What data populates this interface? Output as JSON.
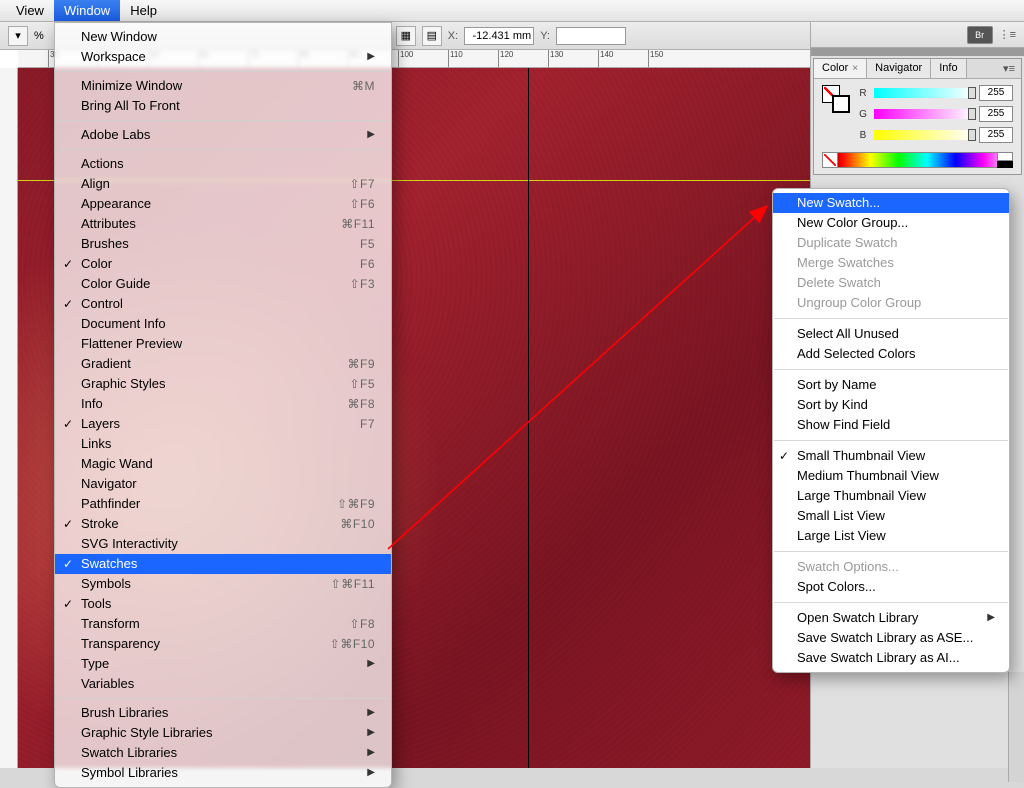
{
  "menubar": {
    "items": [
      "View",
      "Window",
      "Help"
    ],
    "active_index": 1
  },
  "toolbar": {
    "x_label": "X:",
    "y_label": "Y:",
    "x_value": "-12.431 mm",
    "pct": "%"
  },
  "ruler": {
    "ticks": [
      30,
      40,
      50,
      60,
      70,
      80,
      90,
      100,
      110,
      120,
      130,
      140,
      150
    ]
  },
  "window_menu": {
    "groups": [
      [
        {
          "label": "New Window"
        },
        {
          "label": "Workspace",
          "submenu": true
        }
      ],
      [
        {
          "label": "Minimize Window",
          "shortcut": "⌘M"
        },
        {
          "label": "Bring All To Front"
        }
      ],
      [
        {
          "label": "Adobe Labs",
          "submenu": true
        }
      ],
      [
        {
          "label": "Actions"
        },
        {
          "label": "Align",
          "shortcut": "⇧F7"
        },
        {
          "label": "Appearance",
          "shortcut": "⇧F6"
        },
        {
          "label": "Attributes",
          "shortcut": "⌘F11"
        },
        {
          "label": "Brushes",
          "shortcut": "F5"
        },
        {
          "label": "Color",
          "shortcut": "F6",
          "checked": true
        },
        {
          "label": "Color Guide",
          "shortcut": "⇧F3"
        },
        {
          "label": "Control",
          "checked": true
        },
        {
          "label": "Document Info"
        },
        {
          "label": "Flattener Preview"
        },
        {
          "label": "Gradient",
          "shortcut": "⌘F9"
        },
        {
          "label": "Graphic Styles",
          "shortcut": "⇧F5"
        },
        {
          "label": "Info",
          "shortcut": "⌘F8"
        },
        {
          "label": "Layers",
          "shortcut": "F7",
          "checked": true
        },
        {
          "label": "Links"
        },
        {
          "label": "Magic Wand"
        },
        {
          "label": "Navigator"
        },
        {
          "label": "Pathfinder",
          "shortcut": "⇧⌘F9"
        },
        {
          "label": "Stroke",
          "shortcut": "⌘F10",
          "checked": true
        },
        {
          "label": "SVG Interactivity"
        },
        {
          "label": "Swatches",
          "checked": true,
          "selected": true
        },
        {
          "label": "Symbols",
          "shortcut": "⇧⌘F11"
        },
        {
          "label": "Tools",
          "checked": true
        },
        {
          "label": "Transform",
          "shortcut": "⇧F8"
        },
        {
          "label": "Transparency",
          "shortcut": "⇧⌘F10"
        },
        {
          "label": "Type",
          "submenu": true
        },
        {
          "label": "Variables"
        }
      ],
      [
        {
          "label": "Brush Libraries",
          "submenu": true
        },
        {
          "label": "Graphic Style Libraries",
          "submenu": true
        },
        {
          "label": "Swatch Libraries",
          "submenu": true
        },
        {
          "label": "Symbol Libraries",
          "submenu": true
        }
      ]
    ]
  },
  "swatches_flyout": {
    "groups": [
      [
        {
          "label": "New Swatch...",
          "selected": true
        },
        {
          "label": "New Color Group..."
        },
        {
          "label": "Duplicate Swatch",
          "disabled": true
        },
        {
          "label": "Merge Swatches",
          "disabled": true
        },
        {
          "label": "Delete Swatch",
          "disabled": true
        },
        {
          "label": "Ungroup Color Group",
          "disabled": true
        }
      ],
      [
        {
          "label": "Select All Unused"
        },
        {
          "label": "Add Selected Colors"
        }
      ],
      [
        {
          "label": "Sort by Name"
        },
        {
          "label": "Sort by Kind"
        },
        {
          "label": "Show Find Field"
        }
      ],
      [
        {
          "label": "Small Thumbnail View",
          "checked": true
        },
        {
          "label": "Medium Thumbnail View"
        },
        {
          "label": "Large Thumbnail View"
        },
        {
          "label": "Small List View"
        },
        {
          "label": "Large List View"
        }
      ],
      [
        {
          "label": "Swatch Options...",
          "disabled": true
        },
        {
          "label": "Spot Colors..."
        }
      ],
      [
        {
          "label": "Open Swatch Library",
          "submenu": true
        },
        {
          "label": "Save Swatch Library as ASE..."
        },
        {
          "label": "Save Swatch Library as AI..."
        }
      ]
    ]
  },
  "color_panel": {
    "tabs": [
      "Color",
      "Navigator",
      "Info"
    ],
    "active_tab": 0,
    "channels": [
      {
        "ch": "R",
        "val": "255"
      },
      {
        "ch": "G",
        "val": "255"
      },
      {
        "ch": "B",
        "val": "255"
      }
    ]
  },
  "dock": {
    "br_label": "Br"
  }
}
